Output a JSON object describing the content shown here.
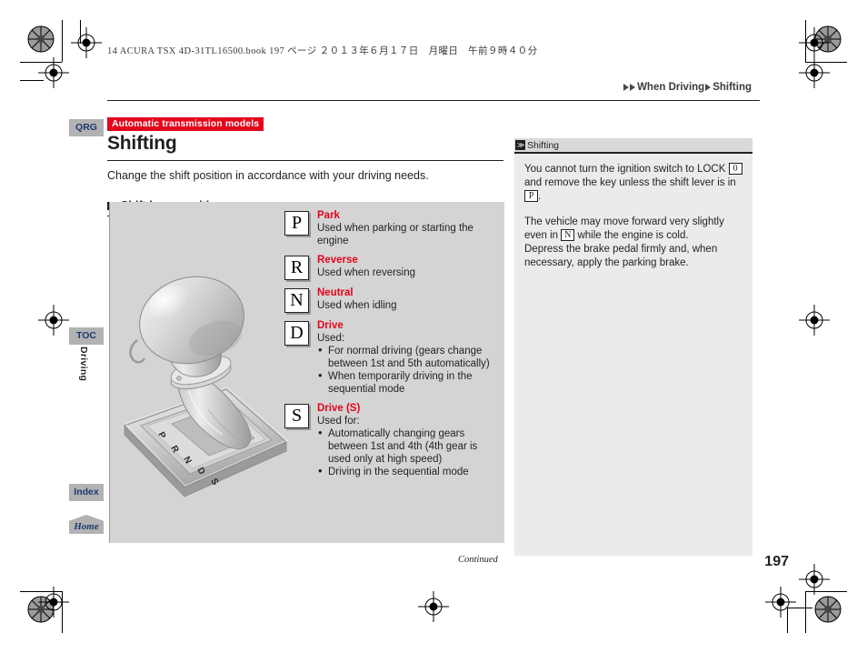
{
  "print_header": "14 ACURA TSX 4D-31TL16500.book  197 ページ  ２０１３年６月１７日　月曜日　午前９時４０分",
  "breadcrumb": {
    "section": "When Driving",
    "topic": "Shifting"
  },
  "rail": {
    "qrg": "QRG",
    "toc": "TOC",
    "index": "Index",
    "home": "Home",
    "chapter": "Driving"
  },
  "main": {
    "badge": "Automatic transmission models",
    "title": "Shifting",
    "intro": "Change the shift position in accordance with your driving needs.",
    "section_heading": "Shift lever positions",
    "lever_gate_labels": [
      "P",
      "R",
      "N",
      "D",
      "S"
    ]
  },
  "gears": [
    {
      "letter": "P",
      "name": "Park",
      "lead": "Used when parking or starting the engine",
      "bullets": []
    },
    {
      "letter": "R",
      "name": "Reverse",
      "lead": "Used when reversing",
      "bullets": []
    },
    {
      "letter": "N",
      "name": "Neutral",
      "lead": "Used when idling",
      "bullets": []
    },
    {
      "letter": "D",
      "name": "Drive",
      "lead": "Used:",
      "bullets": [
        "For normal driving (gears change between 1st and 5th automatically)",
        "When temporarily driving in the sequential mode"
      ]
    },
    {
      "letter": "S",
      "name": "Drive (S)",
      "lead": "Used for:",
      "bullets": [
        "Automatically changing gears between 1st and 4th (4th gear is used only at high speed)",
        "Driving in the sequential mode"
      ]
    }
  ],
  "note": {
    "icon": "≫",
    "heading": "Shifting",
    "p1_part1": "You cannot turn the ignition switch to LOCK ",
    "p1_key1": "0",
    "p1_part2": " and remove the key unless the shift lever is in ",
    "p1_key2": "P",
    "p1_part3": ".",
    "p2_part1": "The vehicle may move forward very slightly even in ",
    "p2_key1": "N",
    "p2_part2": " while the engine is cold.",
    "p3": "Depress the brake pedal firmly and, when necessary, apply the parking brake."
  },
  "footer": {
    "continued": "Continued",
    "page_number": "197"
  },
  "colors": {
    "accent_red": "#e3051b",
    "tab_gray": "#b2b2b2",
    "tab_text_navy": "#1b3a6b",
    "panel_gray": "#d4d4d4",
    "note_gray": "#ebebeb",
    "ink": "#231f20"
  }
}
